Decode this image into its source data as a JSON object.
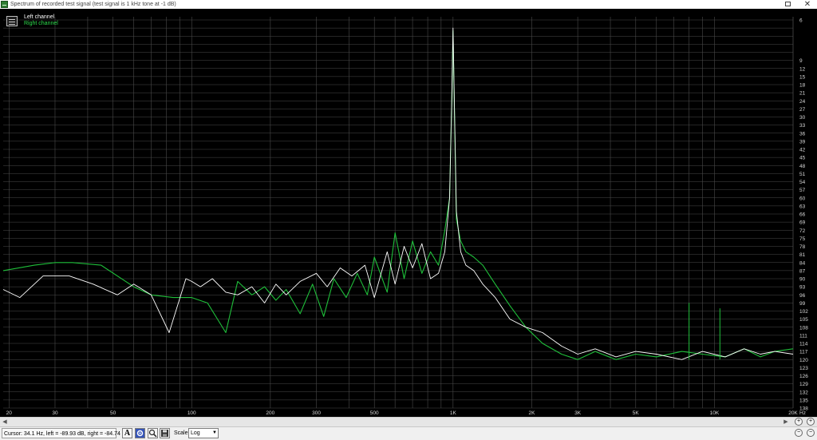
{
  "window": {
    "title": "Spectrum of recorded test signal (test signal is 1 kHz tone at -1 dB)",
    "close_glyph": "✕",
    "icon": "spectrum-app-icon"
  },
  "legend": {
    "left_channel": "Left channel",
    "right_channel": "Right channel"
  },
  "status": {
    "cursor_readout": "Cursor: 34.1 Hz, left = -89.93 dB, right = -84.74 dB",
    "scale_label": "Scale",
    "scale_value": "Log"
  },
  "toolbar": {
    "text_tool": "A",
    "settings_icon": "gear-icon",
    "zoom_tool_icon": "magnifier-icon",
    "save_icon": "floppy-icon"
  },
  "scrollbar": {
    "left_arrow": "◀",
    "right_arrow": "▶"
  },
  "zoom_controls": {
    "zoom_in": "+",
    "zoom_out": "−"
  },
  "colors": {
    "background": "#000000",
    "grid": "#4a4a4a",
    "axis_text": "#d8d8d8",
    "left_channel": "#ffffff",
    "right_channel": "#1fbf3a",
    "legend_right": "#2ddc4c"
  },
  "chart_data": {
    "type": "line",
    "title": "",
    "xlabel": "",
    "ylabel": "",
    "x_scale": "log",
    "x_unit": "Hz",
    "xlim": [
      19,
      20000
    ],
    "ylim": [
      -138,
      6
    ],
    "grid": true,
    "legend_position": "top-left",
    "x_ticks": [
      {
        "value": 20,
        "label": "20"
      },
      {
        "value": 30,
        "label": "30"
      },
      {
        "value": 50,
        "label": "50"
      },
      {
        "value": 100,
        "label": "100"
      },
      {
        "value": 200,
        "label": "200"
      },
      {
        "value": 300,
        "label": "300"
      },
      {
        "value": 500,
        "label": "500"
      },
      {
        "value": 1000,
        "label": "1K"
      },
      {
        "value": 2000,
        "label": "2K"
      },
      {
        "value": 3000,
        "label": "3K"
      },
      {
        "value": 5000,
        "label": "5K"
      },
      {
        "value": 10000,
        "label": "10K"
      },
      {
        "value": 20000,
        "label": "20K"
      }
    ],
    "y_ticks": [
      6,
      3,
      0,
      -3,
      -6,
      -9,
      -12,
      -15,
      -18,
      -21,
      -24,
      -27,
      -30,
      -33,
      -36,
      -39,
      -42,
      -45,
      -48,
      -51,
      -54,
      -57,
      -60,
      -63,
      -66,
      -69,
      -72,
      -75,
      -78,
      -81,
      -84,
      -87,
      -90,
      -93,
      -96,
      -99,
      -102,
      -105,
      -108,
      -111,
      -114,
      -117,
      -120,
      -123,
      -126,
      -129,
      -132,
      -135,
      -138
    ],
    "y_tick_labels": [
      "6",
      "9",
      "12",
      "15",
      "18",
      "21",
      "24",
      "27",
      "30",
      "33",
      "36",
      "39",
      "42",
      "45",
      "48",
      "51",
      "54",
      "57",
      "60",
      "63",
      "66",
      "69",
      "72",
      "75",
      "78",
      "81",
      "84",
      "87",
      "90",
      "93",
      "96",
      "99",
      "102",
      "105",
      "108",
      "111",
      "114",
      "117",
      "120",
      "123",
      "126",
      "129",
      "132",
      "135",
      "138"
    ],
    "series": [
      {
        "name": "Left channel",
        "x": [
          19,
          22,
          27,
          34,
          42,
          52,
          60,
          70,
          82,
          95,
          100,
          108,
          120,
          135,
          150,
          170,
          190,
          210,
          230,
          260,
          300,
          330,
          370,
          410,
          460,
          500,
          560,
          600,
          650,
          700,
          760,
          820,
          880,
          930,
          970,
          990,
          1000,
          1010,
          1030,
          1070,
          1120,
          1200,
          1300,
          1450,
          1650,
          1900,
          2200,
          2600,
          3000,
          3500,
          4200,
          5000,
          6000,
          7500,
          9000,
          11000,
          13000,
          15000,
          17000,
          20000
        ],
        "y": [
          -94,
          -97,
          -89,
          -89,
          -92,
          -96,
          -92,
          -96,
          -110,
          -90,
          -91,
          -93,
          -90,
          -95,
          -96,
          -93,
          -99,
          -92,
          -96,
          -91,
          -88,
          -93,
          -86,
          -89,
          -85,
          -97,
          -80,
          -92,
          -78,
          -86,
          -77,
          -90,
          -88,
          -80,
          -60,
          -20,
          3,
          -20,
          -65,
          -80,
          -85,
          -87,
          -92,
          -97,
          -105,
          -108,
          -110,
          -115,
          -118,
          -116,
          -119,
          -117,
          -118,
          -120,
          -117,
          -119,
          -116,
          -118,
          -117,
          -118
        ]
      },
      {
        "name": "Right channel",
        "x": [
          19,
          25,
          30,
          35,
          45,
          60,
          70,
          85,
          100,
          115,
          135,
          150,
          170,
          190,
          210,
          230,
          260,
          290,
          320,
          350,
          390,
          430,
          470,
          500,
          560,
          600,
          650,
          700,
          760,
          820,
          880,
          930,
          970,
          990,
          1000,
          1010,
          1030,
          1070,
          1120,
          1200,
          1300,
          1450,
          1650,
          1900,
          2200,
          2600,
          3000,
          3500,
          4200,
          5000,
          6000,
          7500,
          9000,
          11000,
          13000,
          15000,
          17000,
          20000
        ],
        "y": [
          -87,
          -85,
          -84,
          -84,
          -85,
          -93,
          -96,
          -97,
          -97,
          -99,
          -110,
          -91,
          -96,
          -93,
          -98,
          -94,
          -103,
          -92,
          -104,
          -90,
          -97,
          -88,
          -96,
          -82,
          -95,
          -73,
          -90,
          -76,
          -88,
          -80,
          -85,
          -72,
          -60,
          -22,
          2,
          -22,
          -68,
          -76,
          -80,
          -82,
          -85,
          -92,
          -100,
          -108,
          -114,
          -118,
          -120,
          -117,
          -120,
          -118,
          -119,
          -117,
          -118,
          -119,
          -116,
          -119,
          -117,
          -116
        ]
      }
    ],
    "spikes": [
      {
        "x": 8000,
        "y": -99
      },
      {
        "x": 10500,
        "y": -101
      }
    ]
  }
}
